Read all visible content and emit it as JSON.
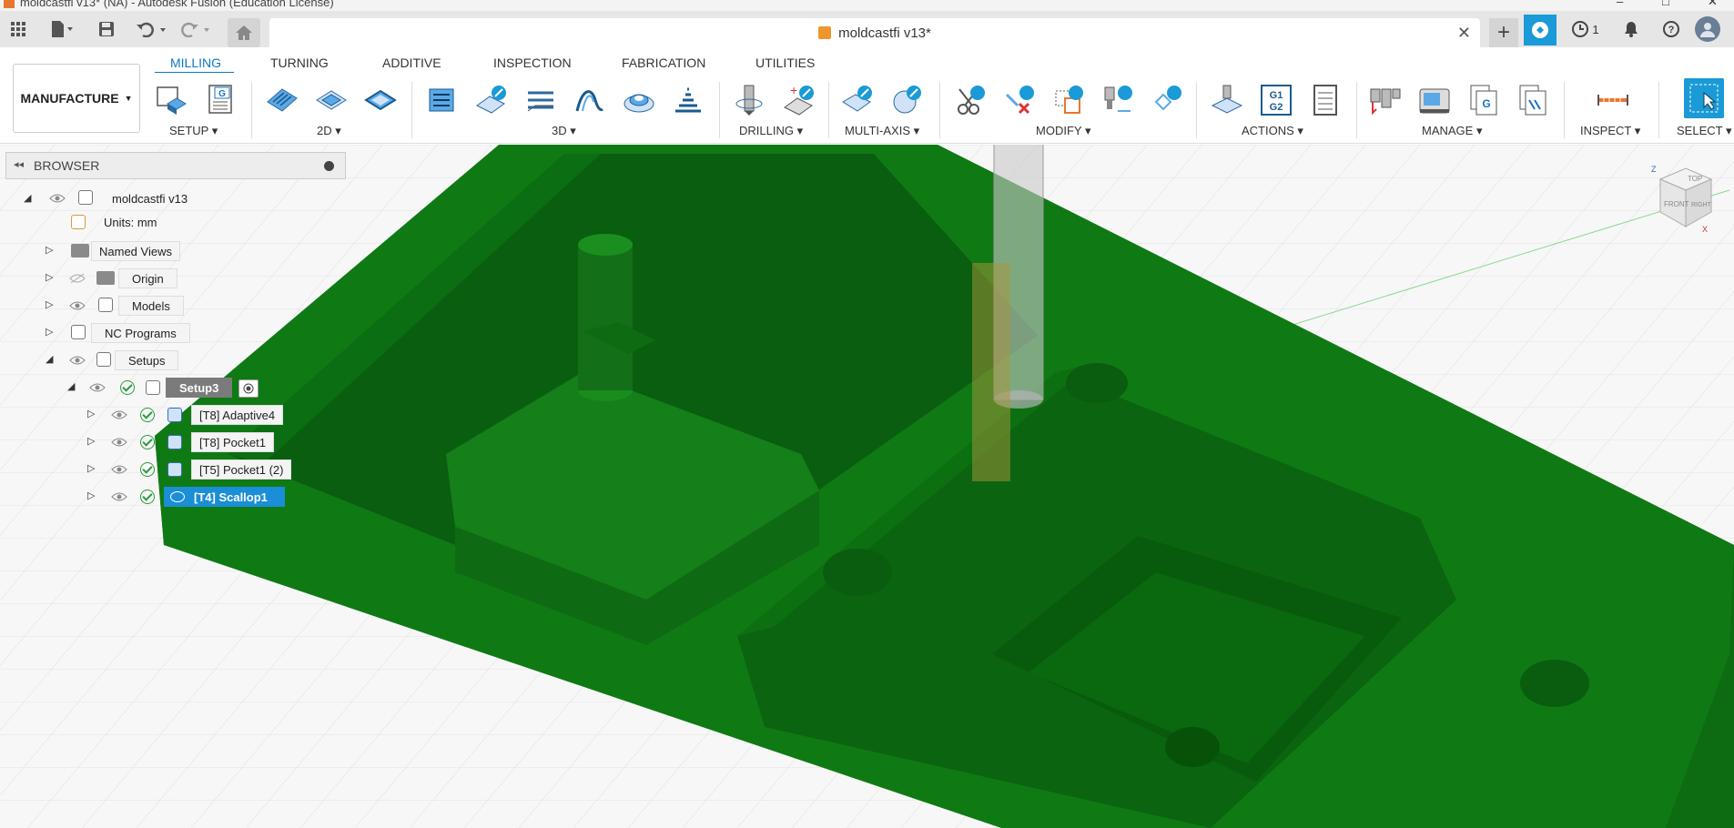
{
  "window": {
    "title": "moldcastfi v13* (NA) - Autodesk Fusion (Education License)"
  },
  "document_tab": {
    "name": "moldcastfi v13*"
  },
  "quick_access": {
    "job_count": "1"
  },
  "workspace": {
    "label": "MANUFACTURE"
  },
  "tabs": [
    {
      "label": "MILLING",
      "active": true
    },
    {
      "label": "TURNING"
    },
    {
      "label": "ADDITIVE"
    },
    {
      "label": "INSPECTION"
    },
    {
      "label": "FABRICATION"
    },
    {
      "label": "UTILITIES"
    }
  ],
  "groups": {
    "setup": "SETUP",
    "twod": "2D",
    "threed": "3D",
    "drilling": "DRILLING",
    "multiaxis": "MULTI-AXIS",
    "modify": "MODIFY",
    "actions": "ACTIONS",
    "manage": "MANAGE",
    "inspect": "INSPECT",
    "select": "SELECT"
  },
  "actions_icon_text": "G1\nG2",
  "browser": {
    "title": "BROWSER",
    "root": "moldcastfi v13",
    "units": "Units: mm",
    "named_views": "Named Views",
    "origin": "Origin",
    "models": "Models",
    "nc_programs": "NC Programs",
    "setups": "Setups",
    "setup3": "Setup3",
    "ops": [
      "[T8] Adaptive4",
      "[T8] Pocket1",
      "[T5] Pocket1 (2)",
      "[T4] Scallop1"
    ]
  },
  "viewcube": {
    "top": "TOP",
    "front": "FRONT",
    "right": "RIGHT",
    "z": "Z",
    "x": "X"
  },
  "colors": {
    "accent": "#0a79c4",
    "part_green": "#0f7a14",
    "selected_row": "#1a8ed6"
  }
}
